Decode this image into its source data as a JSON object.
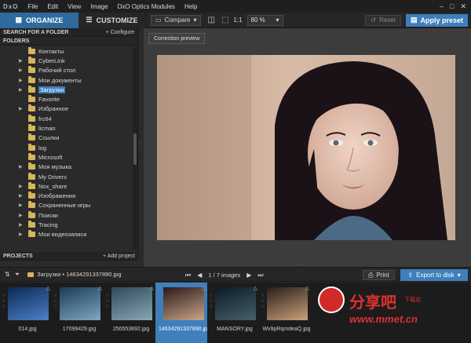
{
  "app": {
    "logo": "DxO"
  },
  "menu": [
    "File",
    "Edit",
    "View",
    "Image",
    "DxO Optics Modules",
    "Help"
  ],
  "tabs": {
    "organize": "ORGANIZE",
    "customize": "CUSTOMIZE"
  },
  "toolbar": {
    "compare": "Compare",
    "ratio": "1:1",
    "zoom": "80 %",
    "reset": "Reset",
    "apply_preset": "Apply preset"
  },
  "sidebar": {
    "search_label": "SEARCH FOR A FOLDER",
    "configure": "+ Configure",
    "folders_label": "FOLDERS",
    "projects_label": "PROJECTS",
    "add_project": "+ Add project",
    "items": [
      {
        "label": "Контакты",
        "arrow": false,
        "selected": false
      },
      {
        "label": "CyberLink",
        "arrow": true,
        "selected": false
      },
      {
        "label": "Рабочий стол",
        "arrow": true,
        "selected": false
      },
      {
        "label": "Мои документы",
        "arrow": true,
        "selected": false
      },
      {
        "label": "Загрузки",
        "arrow": true,
        "selected": true
      },
      {
        "label": "Favorite",
        "arrow": false,
        "selected": false
      },
      {
        "label": "Избранное",
        "arrow": true,
        "selected": false
      },
      {
        "label": "frc64",
        "arrow": false,
        "selected": false
      },
      {
        "label": "licman",
        "arrow": false,
        "selected": false
      },
      {
        "label": "Ссылки",
        "arrow": false,
        "selected": false
      },
      {
        "label": "log",
        "arrow": false,
        "selected": false
      },
      {
        "label": "Microsoft",
        "arrow": false,
        "selected": false
      },
      {
        "label": "Моя музыка",
        "arrow": true,
        "selected": false
      },
      {
        "label": "My Drivers",
        "arrow": false,
        "selected": false
      },
      {
        "label": "Nox_share",
        "arrow": true,
        "selected": false
      },
      {
        "label": "Изображения",
        "arrow": true,
        "selected": false
      },
      {
        "label": "Сохраненные игры",
        "arrow": true,
        "selected": false
      },
      {
        "label": "Поиски",
        "arrow": true,
        "selected": false
      },
      {
        "label": "Tracing",
        "arrow": true,
        "selected": false
      },
      {
        "label": "Мои видеозаписи",
        "arrow": true,
        "selected": false
      }
    ]
  },
  "viewer": {
    "correction_preview": "Correction preview"
  },
  "filmbar": {
    "path": "Загрузки • 14634291337890.jpg",
    "count": "1 / 7 images",
    "print": "Print",
    "export": "Export to disk"
  },
  "thumbnails": [
    {
      "name": "014.jpg",
      "selected": false,
      "colors": [
        "#0b2a55",
        "#4d7fc8"
      ]
    },
    {
      "name": "17099429.jpg",
      "selected": false,
      "colors": [
        "#1b3b58",
        "#7ea8c2"
      ]
    },
    {
      "name": "250553892.jpg",
      "selected": false,
      "colors": [
        "#2e4a5a",
        "#8aa7b5"
      ]
    },
    {
      "name": "14634291337890.jpg",
      "selected": true,
      "colors": [
        "#2a1a1a",
        "#c9a48a"
      ]
    },
    {
      "name": "MANSORY.jpg",
      "selected": false,
      "colors": [
        "#0c1a22",
        "#46606c"
      ]
    },
    {
      "name": "Wv9pRqmdeaQ.jpg",
      "selected": false,
      "colors": [
        "#2a1e1a",
        "#c8a27a"
      ]
    }
  ],
  "watermark": {
    "cn_main": "分享吧",
    "cn_sub": "下载站",
    "url": "www.mmet.cn"
  }
}
